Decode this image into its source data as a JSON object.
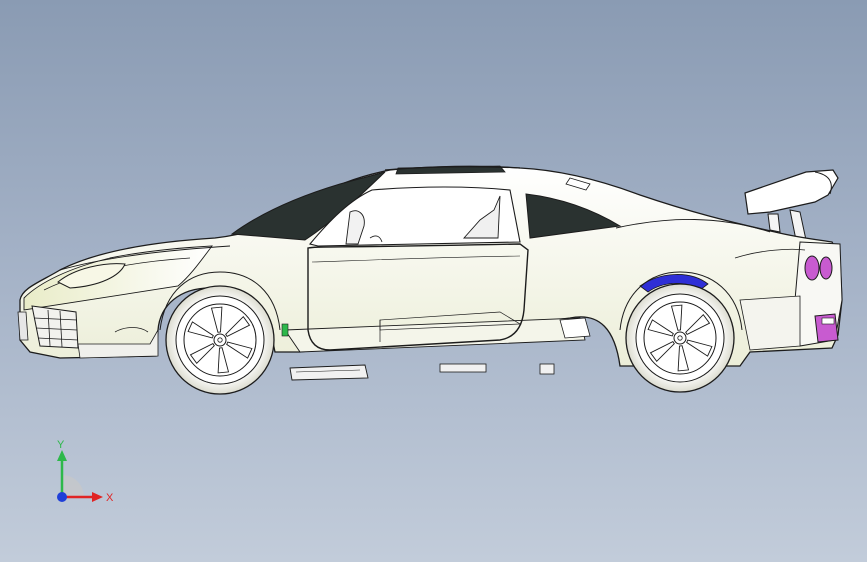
{
  "viewport": {
    "background_top": "#8a9bb3",
    "background_bottom": "#c2ccda",
    "model": "sports-car-side-view"
  },
  "triad": {
    "y_label": "Y",
    "x_label": "X",
    "y_color": "#2db84a",
    "x_color": "#e02424",
    "z_color": "#1f3fd8"
  },
  "colors": {
    "body": "#ffffff",
    "body_shade": "#f1f3e2",
    "edge": "#1c1c1c",
    "glass": "#2a3230",
    "fender_accent": "#2f2fd6",
    "tail_light": "#c85bd0"
  }
}
